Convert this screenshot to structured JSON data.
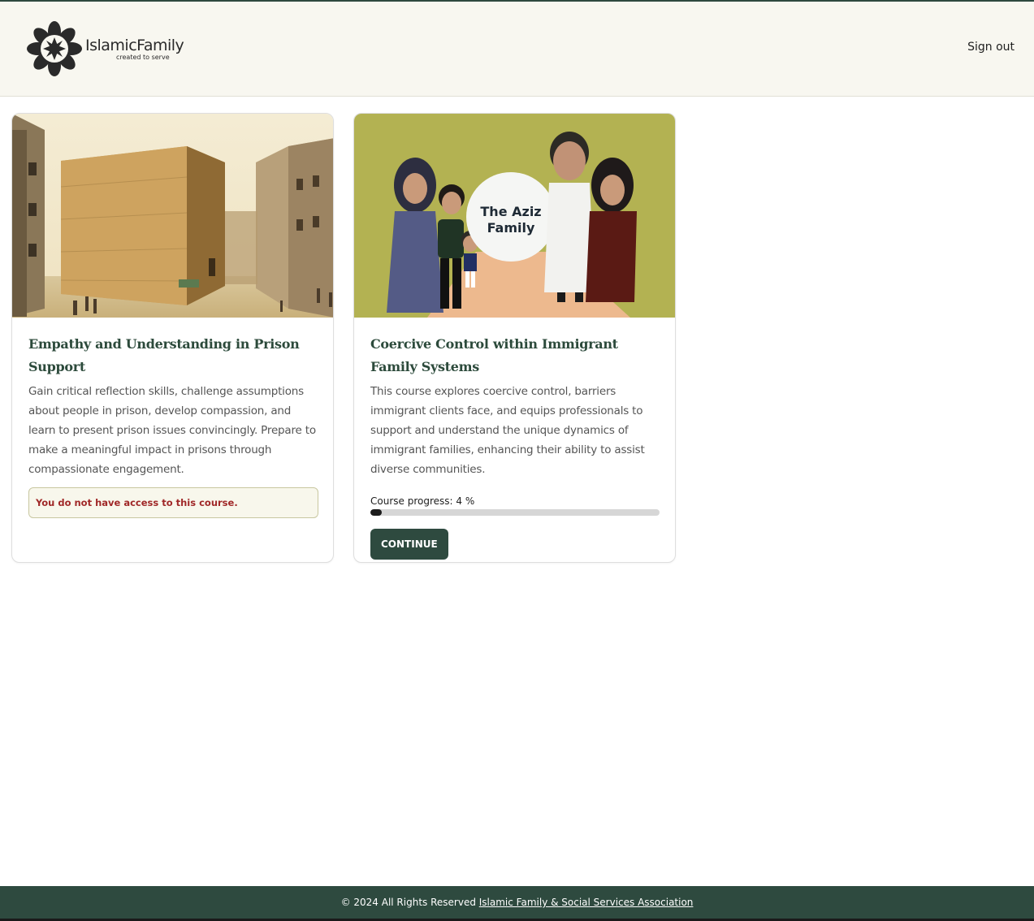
{
  "header": {
    "logo_name": "IslamicFamily",
    "logo_tagline": "created to serve",
    "sign_out_label": "Sign out"
  },
  "courses": [
    {
      "title": "Empathy and Understanding in Prison Support",
      "description": "Gain critical reflection skills, challenge assumptions about people in prison, develop compassion, and learn to present prison issues convincingly. Prepare to make a meaningful impact in prisons through compassionate engagement.",
      "access_message": "You do not have access to this course.",
      "image_icon": "prison-building-illustration"
    },
    {
      "title": "Coercive Control within Immigrant Family Systems",
      "description": "This course explores coercive control, barriers immigrant clients face, and equips professionals to support and understand the unique dynamics of immigrant families, enhancing their ability to assist diverse communities.",
      "image_caption_line1": "The Aziz",
      "image_caption_line2": "Family",
      "progress_label": "Course progress: 4 %",
      "progress_value": 4,
      "continue_label": "CONTINUE",
      "image_icon": "family-illustration"
    }
  ],
  "footer": {
    "copyright": "© 2024 All Rights Reserved",
    "link_text": "Islamic Family & Social Services Association"
  },
  "colors": {
    "brand_green": "#2e4a3f",
    "header_bg": "#f8f7f0",
    "alert_text": "#a02828",
    "image2_bg": "#b3b252"
  }
}
